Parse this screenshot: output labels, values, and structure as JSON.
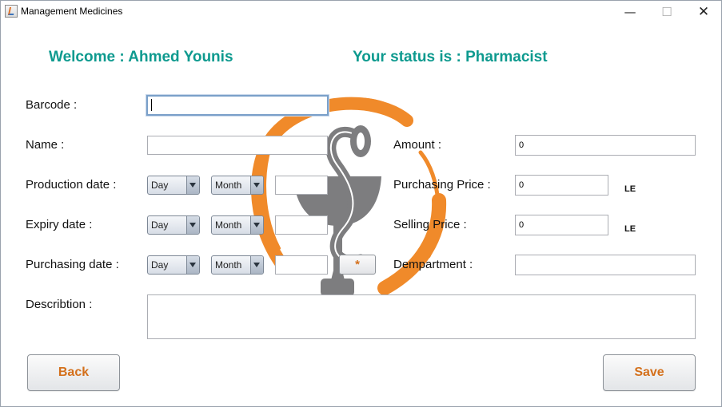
{
  "window": {
    "title": "Management Medicines",
    "minimize_glyph": "—",
    "maximize_glyph": "☐",
    "close_glyph": "✕",
    "app_icon": "java-cup-icon",
    "logo": "pharmacy-caduceus-logo"
  },
  "header": {
    "welcome": "Welcome : Ahmed Younis",
    "status": "Your status is : Pharmacist"
  },
  "form": {
    "barcode_label": "Barcode :",
    "barcode_value": "",
    "name_label": "Name :",
    "name_value": "",
    "production_label": "Production date :",
    "expiry_label": "Expiry date :",
    "purchasing_date_label": "Purchasing date :",
    "day_option": "Day",
    "month_option": "Month",
    "year_value": "",
    "date_picker_label": "*",
    "description_label": "Describtion :",
    "description_value": "",
    "amount_label": "Amount :",
    "amount_value": "0",
    "purchasing_price_label": "Purchasing Price :",
    "purchasing_price_value": "0",
    "selling_price_label": "Selling Price :",
    "selling_price_value": "0",
    "currency": "LE",
    "department_label": "Dempartment :",
    "department_value": ""
  },
  "actions": {
    "back": "Back",
    "save": "Save"
  },
  "colors": {
    "heading": "#0e9a8f",
    "button_text": "#d4701c",
    "logo_orange": "#f08a2a",
    "logo_gray": "#7d7d7f"
  }
}
